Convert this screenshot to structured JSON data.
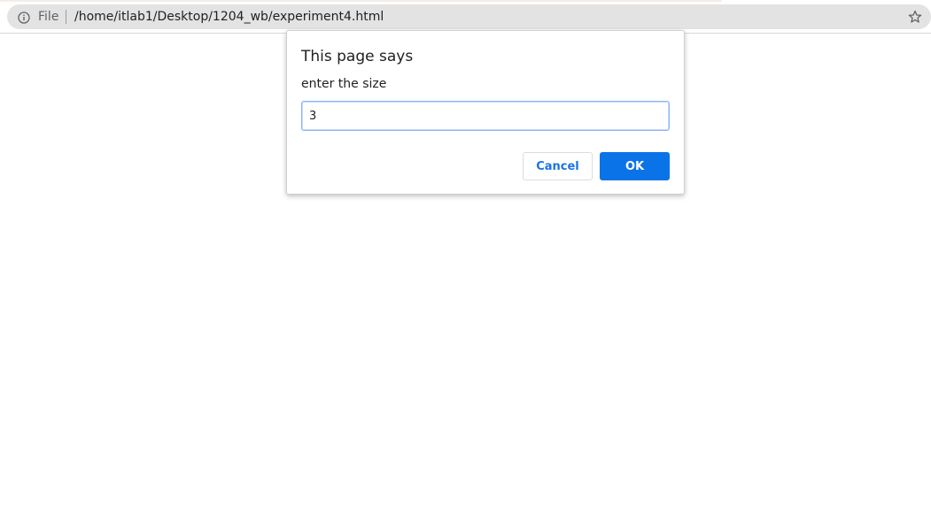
{
  "browser": {
    "scheme_label": "File",
    "url": "/home/itlab1/Desktop/1204_wb/experiment4.html",
    "icons": {
      "left": "info-icon",
      "right": "star-icon"
    }
  },
  "dialog": {
    "title": "This page says",
    "message": "enter the size",
    "input_value": "3",
    "cancel_label": "Cancel",
    "ok_label": "OK"
  },
  "colors": {
    "accent": "#0b73e8",
    "link": "#1a73e8"
  }
}
